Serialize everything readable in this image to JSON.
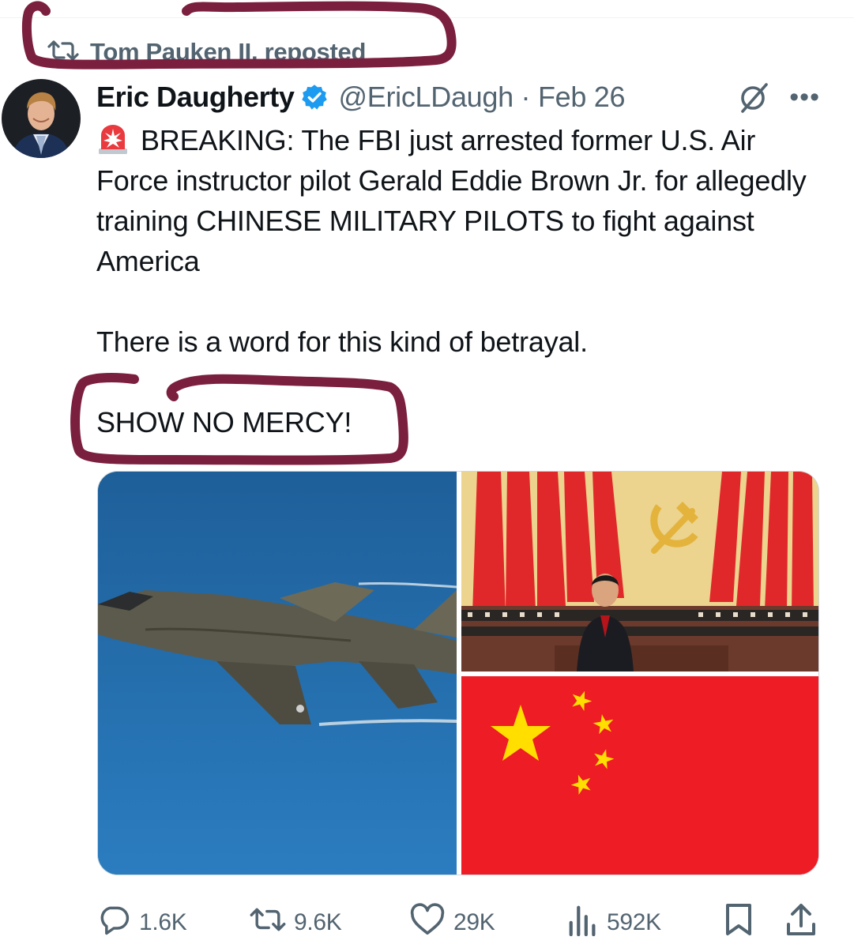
{
  "repost": {
    "label": "Tom Pauken II. reposted",
    "icon": "repost-icon"
  },
  "tweet": {
    "author_name": "Eric Daugherty",
    "verified": true,
    "handle": "@EricLDaugh",
    "date_separator": "·",
    "date": "Feb 26",
    "text_line_1_prefix_icon": "siren-emoji",
    "text_paragraph_1": "BREAKING: The FBI just arrested former U.S. Air Force instructor pilot Gerald Eddie Brown Jr. for allegedly training CHINESE MILITARY PILOTS to fight against America",
    "text_paragraph_2": "There is a word for this kind of betrayal.",
    "text_paragraph_3": "SHOW NO MERCY!"
  },
  "media": {
    "images": [
      {
        "name": "fighter-jet-photo"
      },
      {
        "name": "congress-hall-photo"
      },
      {
        "name": "china-flag-photo"
      }
    ]
  },
  "actions": {
    "reply_count": "1.6K",
    "repost_count": "9.6K",
    "like_count": "29K",
    "views_count": "592K"
  },
  "colors": {
    "accent_blue": "#1d9bf0",
    "muted_gray": "#536471",
    "annotation_marker": "#7b1f3f",
    "flag_red": "#ee1c25",
    "flag_yellow": "#ffde00"
  }
}
